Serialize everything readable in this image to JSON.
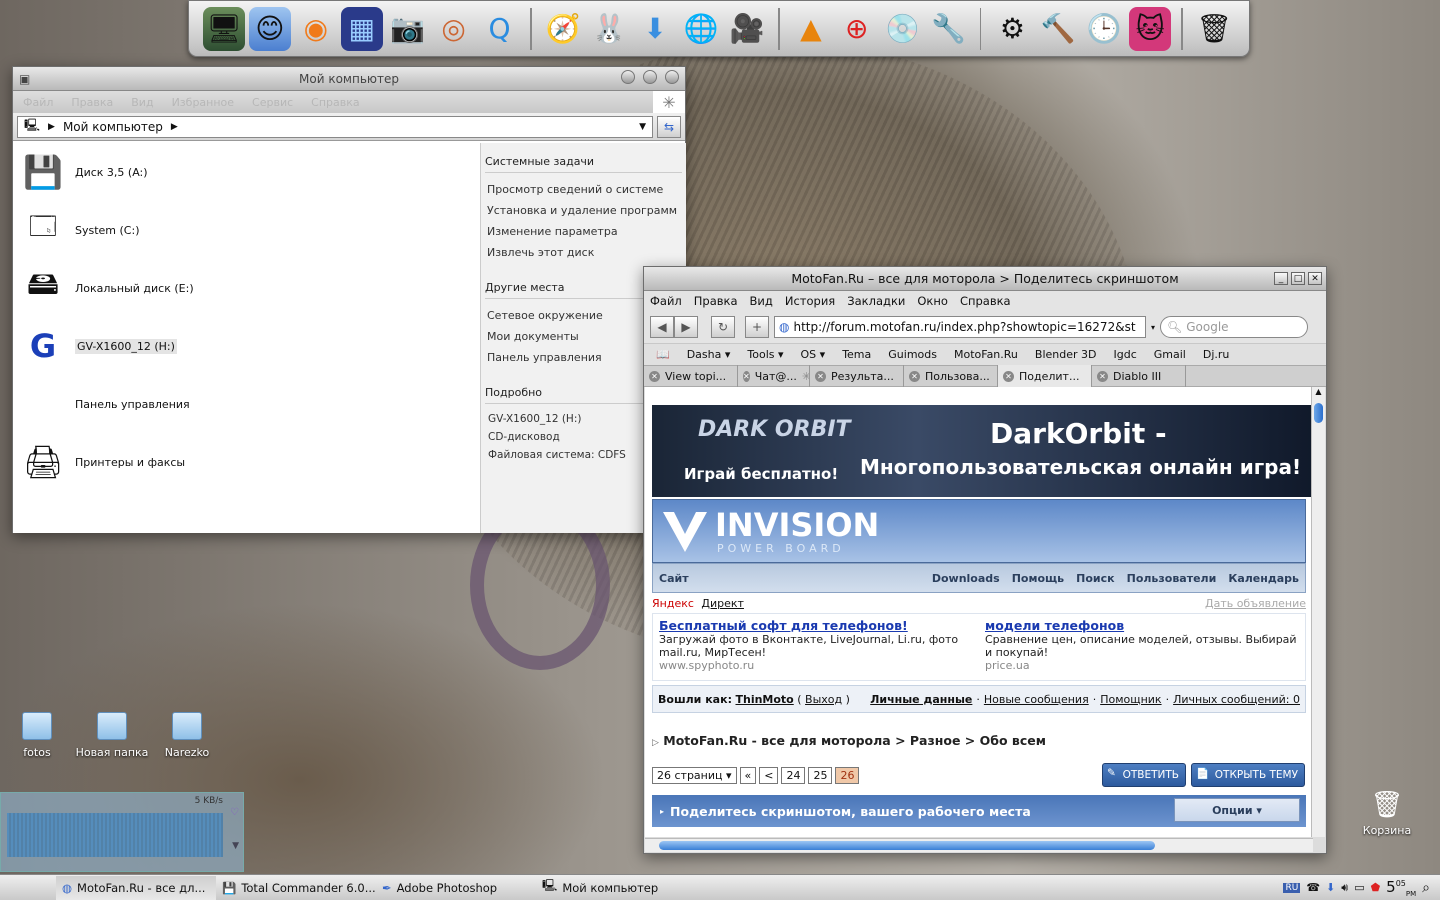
{
  "dock": {
    "icons": [
      "monitor-icon",
      "finder-icon",
      "blender-icon",
      "dashboard-icon",
      "camera-icon",
      "color-ring-icon",
      "quicktime-icon",
      "safari-icon",
      "bunny-icon",
      "download-icon",
      "globe-icon",
      "video-icon",
      "vlc-icon",
      "plus-icon",
      "vinyl-icon",
      "tools-icon",
      "dial-icon",
      "hammer-icon",
      "timemachine-icon",
      "cat-icon",
      "trash-icon"
    ]
  },
  "explorer": {
    "title": "Мой компьютер",
    "menu": [
      "Файл",
      "Правка",
      "Вид",
      "Избранное",
      "Сервис",
      "Справка"
    ],
    "address": "Мой компьютер",
    "drives": [
      {
        "label": "Диск 3,5 (A:)",
        "icon": "floppy-icon"
      },
      {
        "label": "System (C:)",
        "icon": "hdd-windows-icon"
      },
      {
        "label": "Локальный диск (E:)",
        "icon": "hdd-icon"
      },
      {
        "label": "GV-X1600_12 (H:)",
        "icon": "gigabyte-icon"
      },
      {
        "label": "Панель управления",
        "icon": "apple-panel-icon"
      },
      {
        "label": "Принтеры и факсы",
        "icon": "printer-icon"
      }
    ],
    "side": {
      "tasks_title": "Системные задачи",
      "tasks": [
        "Просмотр сведений о системе",
        "Установка и удаление программ",
        "Изменение параметра",
        "Извлечь этот диск"
      ],
      "places_title": "Другие места",
      "places": [
        "Сетевое окружение",
        "Мои документы",
        "Панель управления"
      ],
      "details_title": "Подробно",
      "details": [
        "GV-X1600_12 (H:)",
        "CD-дисковод",
        "Файловая система: CDFS"
      ]
    }
  },
  "browser": {
    "title": "MotoFan.Ru – все для моторола > Поделитесь скриншотом",
    "menu": [
      "Файл",
      "Правка",
      "Вид",
      "История",
      "Закладки",
      "Окно",
      "Справка"
    ],
    "url": "http://forum.motofan.ru/index.php?showtopic=16272&st",
    "search_placeholder": "Google",
    "bookmarks": [
      "Dasha ▾",
      "Tools ▾",
      "OS ▾",
      "Tema",
      "Guimods",
      "MotoFan.Ru",
      "Blender 3D",
      "Igdc",
      "Gmail",
      "Dj.ru"
    ],
    "tabs": [
      "View topi...",
      "Чат@...",
      "Результа...",
      "Пользова...",
      "Поделит...",
      "Diablo III"
    ],
    "banner": {
      "logo": "DARK ORBIT",
      "left": "Играй бесплатно!",
      "title": "DarkOrbit -",
      "subtitle": "Многопользовательская онлайн игра!"
    },
    "ipb": {
      "title": "INVISION",
      "sub": "POWER BOARD"
    },
    "nav": {
      "left": "Сайт",
      "items": [
        "Downloads",
        "Помощь",
        "Поиск",
        "Пользователи",
        "Календарь"
      ]
    },
    "yandex": {
      "ya": "Яндекс",
      "direct": "Директ",
      "place": "Дать объявление"
    },
    "ads": [
      {
        "title": "Бесплатный софт для телефонов!",
        "desc": "Загружай фото в Вконтакте, LiveJournal, Li.ru, фото mail.ru, МирТесен!",
        "url": "www.spyphoto.ru"
      },
      {
        "title": "модели телефонов",
        "desc": "Сравнение цен, описание моделей, отзывы. Выбирай и покупай!",
        "url": "price.ua"
      }
    ],
    "login": {
      "as": "Вошли как:",
      "user": "ThinMoto",
      "exit": "Выход",
      "links": [
        "Личные данные",
        "Новые сообщения",
        "Помощник",
        "Личных сообщений: 0"
      ]
    },
    "crumb": "MotoFan.Ru - все для моторола > Разное > Обо всем",
    "pager": {
      "pages": "26 страниц ▾",
      "first": "«",
      "prev": "<",
      "p1": "24",
      "p2": "25",
      "cur": "26"
    },
    "reply": "ОТВЕТИТЬ",
    "newtopic": "ОТКРЫТЬ ТЕМУ",
    "topic": "Поделитесь скриншотом, вашего рабочего места",
    "options": "Опции ▾"
  },
  "desktop_icons": [
    "fotos",
    "Новая папка",
    "Narezko"
  ],
  "trash": "Корзина",
  "monitor": {
    "speed": "5 KB/s"
  },
  "taskbar": {
    "items": [
      "MotoFan.Ru - все дл...",
      "Total Commander 6.0...",
      "Adobe Photoshop",
      "Мой компьютер"
    ],
    "lang": "RU",
    "time": "5",
    "time_min": "05",
    "ampm": "PM"
  }
}
